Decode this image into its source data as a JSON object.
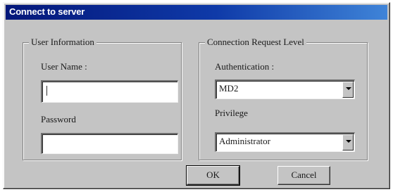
{
  "window": {
    "title": "Connect to server"
  },
  "user_information": {
    "legend": "User Information",
    "username_label": "User Name :",
    "username_value": "",
    "password_label": "Password",
    "password_value": ""
  },
  "connection_request_level": {
    "legend": "Connection Request Level",
    "authentication_label": "Authentication :",
    "authentication_value": "MD2",
    "privilege_label": "Privilege",
    "privilege_value": "Administrator"
  },
  "buttons": {
    "ok_label": "OK",
    "cancel_label": "Cancel"
  }
}
